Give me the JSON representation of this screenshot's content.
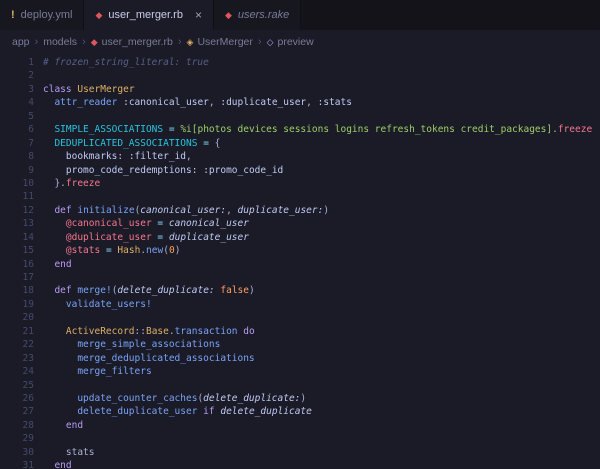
{
  "icons": {
    "warning": "!",
    "ruby": "◆",
    "close": "×",
    "chevron": "›",
    "class": "◈",
    "method": "◇"
  },
  "colors": {
    "editor_background": "#1a1b26",
    "tabbar_background": "#131319",
    "keyword": "#bb9af7",
    "class_name": "#e0af68",
    "function": "#7aa2f7",
    "constant": "#2ac3de",
    "string": "#9ece6a",
    "instance_variable": "#f7768e",
    "number": "#ff9e64",
    "comment": "#565f89",
    "ruby_icon": "#e0565e",
    "warning_icon": "#e0af68"
  },
  "tabs": [
    {
      "id": "deploy-yml",
      "icon": "warning",
      "label": "deploy.yml",
      "active": false,
      "preview": false,
      "close": false
    },
    {
      "id": "user-merger-rb",
      "icon": "ruby",
      "label": "user_merger.rb",
      "active": true,
      "preview": false,
      "close": true
    },
    {
      "id": "users-rake",
      "icon": "ruby",
      "label": "users.rake",
      "active": false,
      "preview": true,
      "close": false
    }
  ],
  "breadcrumb": [
    {
      "label": "app"
    },
    {
      "label": "models"
    },
    {
      "label": "user_merger.rb",
      "icon": "ruby"
    },
    {
      "label": "UserMerger",
      "icon": "class"
    },
    {
      "label": "preview",
      "icon": "method"
    }
  ],
  "editor": {
    "lines": [
      [
        {
          "t": "# frozen_string_literal: true",
          "s": "cm"
        }
      ],
      [],
      [
        {
          "t": "class",
          "s": "kw"
        },
        {
          "t": " ",
          "s": "txt"
        },
        {
          "t": "UserMerger",
          "s": "cls"
        }
      ],
      [
        {
          "t": "  ",
          "s": "txt"
        },
        {
          "t": "attr_reader",
          "s": "fn"
        },
        {
          "t": " ",
          "s": "txt"
        },
        {
          "t": ":canonical_user",
          "s": "sym"
        },
        {
          "t": ", ",
          "s": "txt"
        },
        {
          "t": ":duplicate_user",
          "s": "sym"
        },
        {
          "t": ", ",
          "s": "txt"
        },
        {
          "t": ":stats",
          "s": "sym"
        }
      ],
      [],
      [
        {
          "t": "  ",
          "s": "txt"
        },
        {
          "t": "SIMPLE_ASSOCIATIONS",
          "s": "const"
        },
        {
          "t": " ",
          "s": "txt"
        },
        {
          "t": "=",
          "s": "op"
        },
        {
          "t": " ",
          "s": "txt"
        },
        {
          "t": "%i[photos devices sessions logins refresh_tokens credit_packages]",
          "s": "str"
        },
        {
          "t": ".",
          "s": "txt"
        },
        {
          "t": "freeze",
          "s": "red"
        }
      ],
      [
        {
          "t": "  ",
          "s": "txt"
        },
        {
          "t": "DEDUPLICATED_ASSOCIATIONS",
          "s": "const"
        },
        {
          "t": " ",
          "s": "txt"
        },
        {
          "t": "=",
          "s": "op"
        },
        {
          "t": " {",
          "s": "txt"
        }
      ],
      [
        {
          "t": "    ",
          "s": "txt"
        },
        {
          "t": "bookmarks:",
          "s": "sym"
        },
        {
          "t": " ",
          "s": "txt"
        },
        {
          "t": ":filter_id",
          "s": "sym"
        },
        {
          "t": ",",
          "s": "txt"
        }
      ],
      [
        {
          "t": "    ",
          "s": "txt"
        },
        {
          "t": "promo_code_redemptions:",
          "s": "sym"
        },
        {
          "t": " ",
          "s": "txt"
        },
        {
          "t": ":promo_code_id",
          "s": "sym"
        }
      ],
      [
        {
          "t": "  }.",
          "s": "txt"
        },
        {
          "t": "freeze",
          "s": "red"
        }
      ],
      [],
      [
        {
          "t": "  ",
          "s": "txt"
        },
        {
          "t": "def",
          "s": "kw"
        },
        {
          "t": " ",
          "s": "txt"
        },
        {
          "t": "initialize",
          "s": "fn"
        },
        {
          "t": "(",
          "s": "txt"
        },
        {
          "t": "canonical_user:",
          "s": "prm"
        },
        {
          "t": ", ",
          "s": "txt"
        },
        {
          "t": "duplicate_user:",
          "s": "prm"
        },
        {
          "t": ")",
          "s": "txt"
        }
      ],
      [
        {
          "t": "    ",
          "s": "txt"
        },
        {
          "t": "@canonical_user",
          "s": "ivar"
        },
        {
          "t": " ",
          "s": "txt"
        },
        {
          "t": "=",
          "s": "op"
        },
        {
          "t": " ",
          "s": "txt"
        },
        {
          "t": "canonical_user",
          "s": "vit"
        }
      ],
      [
        {
          "t": "    ",
          "s": "txt"
        },
        {
          "t": "@duplicate_user",
          "s": "ivar"
        },
        {
          "t": " ",
          "s": "txt"
        },
        {
          "t": "=",
          "s": "op"
        },
        {
          "t": " ",
          "s": "txt"
        },
        {
          "t": "duplicate_user",
          "s": "vit"
        }
      ],
      [
        {
          "t": "    ",
          "s": "txt"
        },
        {
          "t": "@stats",
          "s": "ivar"
        },
        {
          "t": " ",
          "s": "txt"
        },
        {
          "t": "=",
          "s": "op"
        },
        {
          "t": " ",
          "s": "txt"
        },
        {
          "t": "Hash",
          "s": "cls"
        },
        {
          "t": ".",
          "s": "txt"
        },
        {
          "t": "new",
          "s": "fn"
        },
        {
          "t": "(",
          "s": "txt"
        },
        {
          "t": "0",
          "s": "num"
        },
        {
          "t": ")",
          "s": "txt"
        }
      ],
      [
        {
          "t": "  ",
          "s": "txt"
        },
        {
          "t": "end",
          "s": "kw"
        }
      ],
      [],
      [
        {
          "t": "  ",
          "s": "txt"
        },
        {
          "t": "def",
          "s": "kw"
        },
        {
          "t": " ",
          "s": "txt"
        },
        {
          "t": "merge!",
          "s": "fn"
        },
        {
          "t": "(",
          "s": "txt"
        },
        {
          "t": "delete_duplicate:",
          "s": "prm"
        },
        {
          "t": " ",
          "s": "txt"
        },
        {
          "t": "false",
          "s": "num"
        },
        {
          "t": ")",
          "s": "txt"
        }
      ],
      [
        {
          "t": "    ",
          "s": "txt"
        },
        {
          "t": "validate_users!",
          "s": "fn"
        }
      ],
      [],
      [
        {
          "t": "    ",
          "s": "txt"
        },
        {
          "t": "ActiveRecord",
          "s": "cls"
        },
        {
          "t": "::",
          "s": "txt"
        },
        {
          "t": "Base",
          "s": "cls"
        },
        {
          "t": ".",
          "s": "txt"
        },
        {
          "t": "transaction",
          "s": "fn"
        },
        {
          "t": " ",
          "s": "txt"
        },
        {
          "t": "do",
          "s": "kw"
        }
      ],
      [
        {
          "t": "      ",
          "s": "txt"
        },
        {
          "t": "merge_simple_associations",
          "s": "fn"
        }
      ],
      [
        {
          "t": "      ",
          "s": "txt"
        },
        {
          "t": "merge_deduplicated_associations",
          "s": "fn"
        }
      ],
      [
        {
          "t": "      ",
          "s": "txt"
        },
        {
          "t": "merge_filters",
          "s": "fn"
        }
      ],
      [],
      [
        {
          "t": "      ",
          "s": "txt"
        },
        {
          "t": "update_counter_caches",
          "s": "fn"
        },
        {
          "t": "(",
          "s": "txt"
        },
        {
          "t": "delete_duplicate:",
          "s": "prm"
        },
        {
          "t": ")",
          "s": "txt"
        }
      ],
      [
        {
          "t": "      ",
          "s": "txt"
        },
        {
          "t": "delete_duplicate_user",
          "s": "fn"
        },
        {
          "t": " ",
          "s": "txt"
        },
        {
          "t": "if",
          "s": "kw"
        },
        {
          "t": " ",
          "s": "txt"
        },
        {
          "t": "delete_duplicate",
          "s": "vit"
        }
      ],
      [
        {
          "t": "    ",
          "s": "txt"
        },
        {
          "t": "end",
          "s": "kw"
        }
      ],
      [],
      [
        {
          "t": "    ",
          "s": "txt"
        },
        {
          "t": "stats",
          "s": "txt"
        }
      ],
      [
        {
          "t": "  ",
          "s": "txt"
        },
        {
          "t": "end",
          "s": "kw"
        }
      ]
    ]
  }
}
